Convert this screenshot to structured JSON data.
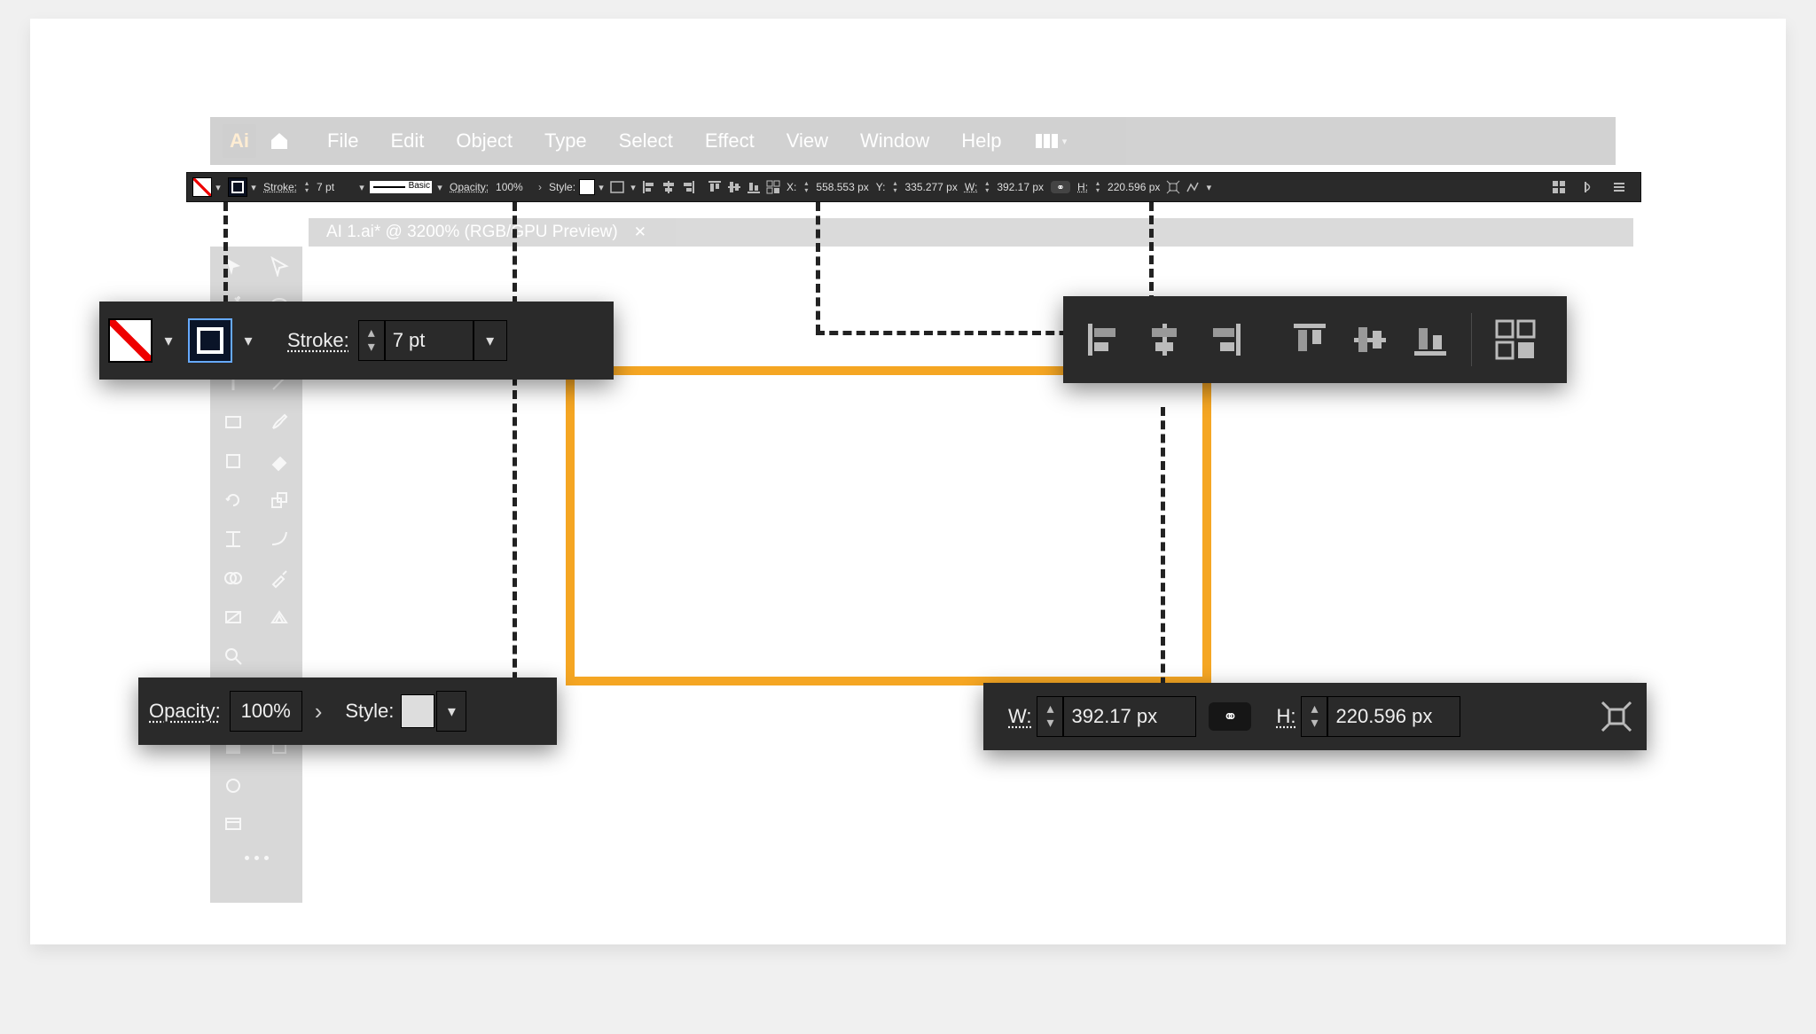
{
  "app_logo": "Ai",
  "menu": [
    "File",
    "Edit",
    "Object",
    "Type",
    "Select",
    "Effect",
    "View",
    "Window",
    "Help"
  ],
  "tab_title": "AI 1.ai* @ 3200% (RGB/GPU Preview)",
  "control_bar": {
    "stroke_label": "Stroke:",
    "stroke_value": "7 pt",
    "brush_name": "Basic",
    "opacity_label": "Opacity:",
    "opacity_value": "100%",
    "style_label": "Style:",
    "x_label": "X:",
    "x_value": "558.553 px",
    "y_label": "Y:",
    "y_value": "335.277 px",
    "w_label": "W:",
    "w_value": "392.17 px",
    "h_label": "H:",
    "h_value": "220.596 px"
  },
  "pop_stroke": {
    "label": "Stroke:",
    "value": "7 pt"
  },
  "pop_opacity": {
    "opacity_label": "Opacity:",
    "opacity_value": "100%",
    "style_label": "Style:"
  },
  "pop_wh": {
    "w_label": "W:",
    "w_value": "392.17 px",
    "h_label": "H:",
    "h_value": "220.596 px"
  }
}
